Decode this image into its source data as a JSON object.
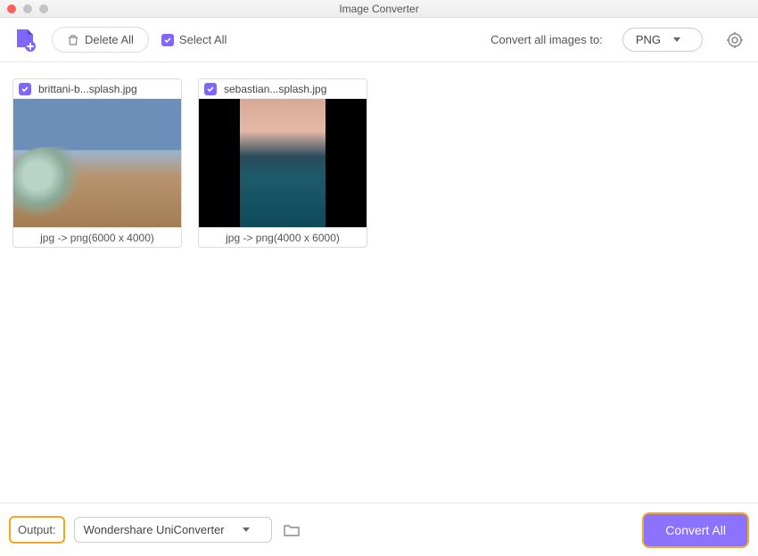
{
  "window": {
    "title": "Image Converter"
  },
  "toolbar": {
    "delete_all": "Delete All",
    "select_all": "Select All",
    "convert_label": "Convert all images to:",
    "format_selected": "PNG"
  },
  "images": [
    {
      "filename": "brittani-b...splash.jpg",
      "conversion": "jpg -> png(6000 x 4000)"
    },
    {
      "filename": "sebastian...splash.jpg",
      "conversion": "jpg -> png(4000 x 6000)"
    }
  ],
  "footer": {
    "output_label": "Output:",
    "output_path": "Wondershare UniConverter",
    "convert_all": "Convert All"
  }
}
